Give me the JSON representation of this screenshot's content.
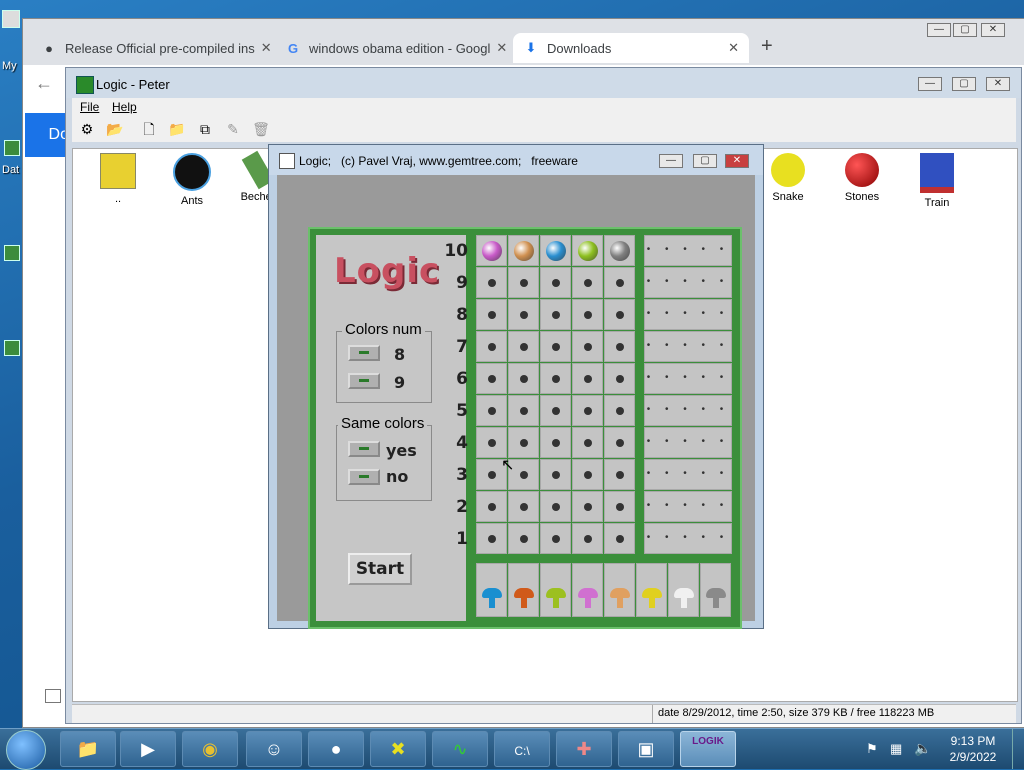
{
  "desktop": {
    "labels": [
      "My",
      "Dat"
    ]
  },
  "chrome": {
    "tabs": [
      {
        "title": "Release Official pre-compiled ins",
        "icon": "github-icon"
      },
      {
        "title": "windows obama edition - Googl",
        "icon": "google-icon"
      },
      {
        "title": "Downloads",
        "icon": "download-icon"
      }
    ],
    "new_tab": "+",
    "page_fragment": "Do"
  },
  "peter": {
    "title": "Logic - Peter",
    "menu": [
      "File",
      "Help"
    ],
    "files": [
      {
        "label": "..",
        "icon": "folder-up-icon"
      },
      {
        "label": "Ants",
        "icon": "ant-icon"
      },
      {
        "label": "Becher",
        "icon": "becher-icon"
      },
      {
        "label": "Snake",
        "icon": "snake-icon"
      },
      {
        "label": "Stones",
        "icon": "stone-icon"
      },
      {
        "label": "Train",
        "icon": "train-icon"
      }
    ],
    "status": "date 8/29/2012, time 2:50, size 379 KB / free 118223 MB"
  },
  "logic": {
    "title": "Logic;   (c) Pavel Vraj, www.gemtree.com;   freeware",
    "logo": "Logic",
    "colors_num": {
      "title": "Colors num",
      "options": [
        "8",
        "9"
      ]
    },
    "same_colors": {
      "title": "Same colors",
      "options": [
        "yes",
        "no"
      ]
    },
    "start": "Start",
    "rows": [
      "10",
      "9",
      "8",
      "7",
      "6",
      "5",
      "4",
      "3",
      "2",
      "1"
    ],
    "hint_dots": "• • • • •",
    "secret_colors": [
      "#c85ac8",
      "#d09050",
      "#2a8fd0",
      "#8ec020",
      "#808080"
    ],
    "palette": [
      "#1a8fd0",
      "#d05a1a",
      "#9cc020",
      "#d070d0",
      "#e0a060",
      "#e0d020",
      "#f0f0f0",
      "#8a8a8a"
    ]
  },
  "taskbar": {
    "time": "9:13 PM",
    "date": "2/9/2022",
    "logik_label": "LOGIK"
  },
  "colors": {
    "board_green": "#3b8f3b",
    "logo_red": "#c85060",
    "taskbar": "#2a5a85"
  }
}
